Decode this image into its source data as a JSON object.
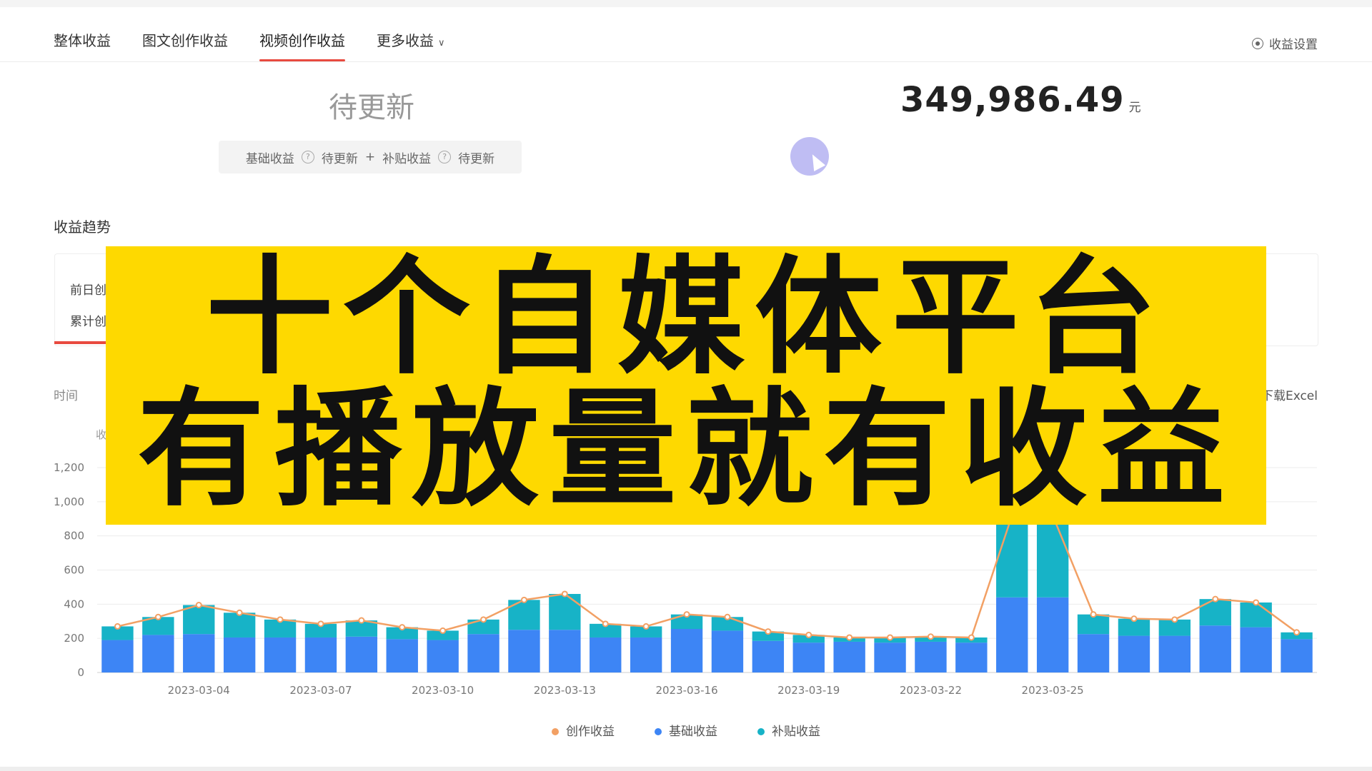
{
  "tabs": [
    {
      "label": "整体收益"
    },
    {
      "label": "图文创作收益"
    },
    {
      "label": "视频创作收益"
    },
    {
      "label": "更多收益"
    }
  ],
  "settings_label": "收益设置",
  "summary": {
    "pending": "待更新",
    "base_label": "基础收益",
    "base_value": "待更新",
    "plus": "+",
    "subsidy_label": "补贴收益",
    "subsidy_value": "待更新",
    "total_value": "349,986.49",
    "total_unit": "元"
  },
  "trend": {
    "title": "收益趋势",
    "card_line1": "前日创",
    "card_line2": "累计创",
    "time_label": "时间",
    "excel_label": "下载Excel",
    "y_unit": "收"
  },
  "banner": {
    "line1": "十个自媒体平台",
    "line2": "有播放量就有收益"
  },
  "colors": {
    "accent": "#e84a3f",
    "base": "#3d85f5",
    "subsidy": "#17b3c7",
    "creation": "#f2a064",
    "banner_bg": "#fed900"
  },
  "chart_data": {
    "type": "bar",
    "stacked": true,
    "x": [
      "2023-03-02",
      "2023-03-03",
      "2023-03-04",
      "2023-03-05",
      "2023-03-06",
      "2023-03-07",
      "2023-03-08",
      "2023-03-09",
      "2023-03-10",
      "2023-03-11",
      "2023-03-12",
      "2023-03-13",
      "2023-03-14",
      "2023-03-15",
      "2023-03-16",
      "2023-03-17",
      "2023-03-18",
      "2023-03-19",
      "2023-03-20",
      "2023-03-21",
      "2023-03-22",
      "2023-03-23",
      "2023-03-24",
      "2023-03-25",
      "2023-03-26",
      "2023-03-27",
      "2023-03-28",
      "2023-03-29",
      "2023-03-30",
      "2023-03-31"
    ],
    "x_tick_labels": [
      "2023-03-04",
      "2023-03-07",
      "2023-03-10",
      "2023-03-13",
      "2023-03-16",
      "2023-03-19",
      "2023-03-22",
      "2023-03-25"
    ],
    "ylim": [
      0,
      1200
    ],
    "yticks": [
      0,
      200,
      400,
      600,
      800,
      "1,000",
      "1,200"
    ],
    "series": [
      {
        "name": "基础收益",
        "values": [
          190,
          220,
          225,
          205,
          205,
          205,
          210,
          195,
          190,
          225,
          250,
          250,
          205,
          205,
          255,
          245,
          185,
          175,
          180,
          175,
          180,
          175,
          440,
          440,
          225,
          215,
          215,
          275,
          265,
          195
        ]
      },
      {
        "name": "补贴收益",
        "values": [
          80,
          105,
          170,
          145,
          105,
          80,
          95,
          70,
          55,
          85,
          175,
          210,
          80,
          65,
          85,
          80,
          55,
          45,
          25,
          30,
          30,
          30,
          480,
          480,
          115,
          100,
          95,
          155,
          145,
          40
        ]
      },
      {
        "name": "创作收益",
        "values": [
          270,
          325,
          395,
          350,
          310,
          285,
          305,
          265,
          245,
          310,
          425,
          460,
          285,
          270,
          340,
          325,
          240,
          220,
          205,
          205,
          210,
          205,
          920,
          920,
          340,
          315,
          310,
          430,
          410,
          235
        ]
      }
    ],
    "grid": true,
    "legend_position": "bottom"
  }
}
